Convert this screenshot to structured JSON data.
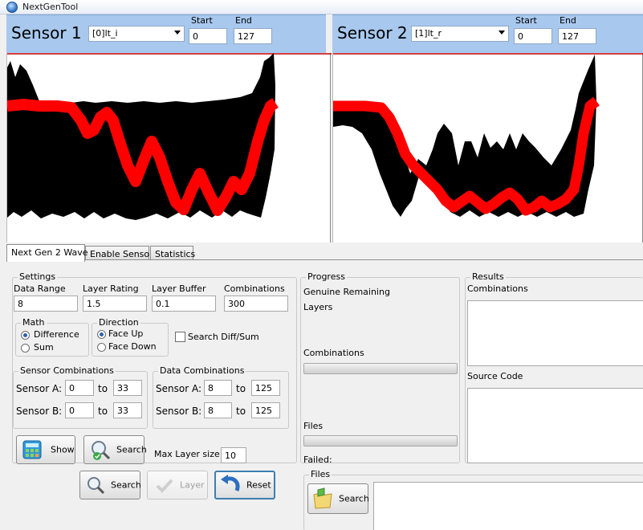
{
  "window": {
    "title": "NextGenTool"
  },
  "sensors": [
    {
      "name": "Sensor 1",
      "channel": "[0]lt_i",
      "start_label": "Start",
      "end_label": "End",
      "start": "0",
      "end": "127"
    },
    {
      "name": "Sensor 2",
      "channel": "[1]lt_r",
      "start_label": "Start",
      "end_label": "End",
      "start": "0",
      "end": "127"
    }
  ],
  "tabs": [
    {
      "label": "Next Gen 2 Wave",
      "active": true
    },
    {
      "label": "Enable Sensor",
      "active": false
    },
    {
      "label": "Statistics",
      "active": false
    }
  ],
  "settings": {
    "legend": "Settings",
    "data_range_label": "Data Range",
    "data_range": "8",
    "layer_rating_label": "Layer Rating",
    "layer_rating": "1.5",
    "layer_buffer_label": "Layer Buffer",
    "layer_buffer": "0.1",
    "combinations_label": "Combinations",
    "combinations": "300",
    "math": {
      "legend": "Math",
      "options": [
        "Difference",
        "Sum"
      ],
      "selected": "Difference"
    },
    "direction": {
      "legend": "Direction",
      "options": [
        "Face Up",
        "Face Down"
      ],
      "selected": "Face Up"
    },
    "search_diff_sum_label": "Search Diff/Sum",
    "sensor_combinations": {
      "legend": "Sensor Combinations",
      "sensor_a_label": "Sensor A:",
      "sensor_a_from": "0",
      "sensor_a_to": "33",
      "sensor_b_label": "Sensor B:",
      "sensor_b_from": "0",
      "sensor_b_to": "33",
      "to_label": "to"
    },
    "data_combinations": {
      "legend": "Data Combinations",
      "sensor_a_label": "Sensor A:",
      "sensor_a_from": "8",
      "sensor_a_to": "125",
      "sensor_b_label": "Sensor B:",
      "sensor_b_from": "8",
      "sensor_b_to": "125",
      "to_label": "to"
    },
    "show_button": "Show",
    "search_button": "Search",
    "max_layer_size_label": "Max Layer size:",
    "max_layer_size": "10"
  },
  "bottom_buttons": {
    "search": "Search",
    "layer": "Layer",
    "reset": "Reset"
  },
  "progress": {
    "legend": "Progress",
    "genuine_remaining_label": "Genuine Remaining",
    "layers_label": "Layers",
    "combinations_label": "Combinations",
    "files_label": "Files",
    "failed_label": "Failed:"
  },
  "files": {
    "legend": "Files",
    "search_button": "Search"
  },
  "results": {
    "legend": "Results",
    "combinations_label": "Combinations",
    "source_code_label": "Source Code"
  },
  "colors": {
    "header_bg": "#a8c8ee",
    "trace_black": "#000000",
    "trace_red": "#ff0000",
    "chart_top_line": "#cc0000"
  }
}
